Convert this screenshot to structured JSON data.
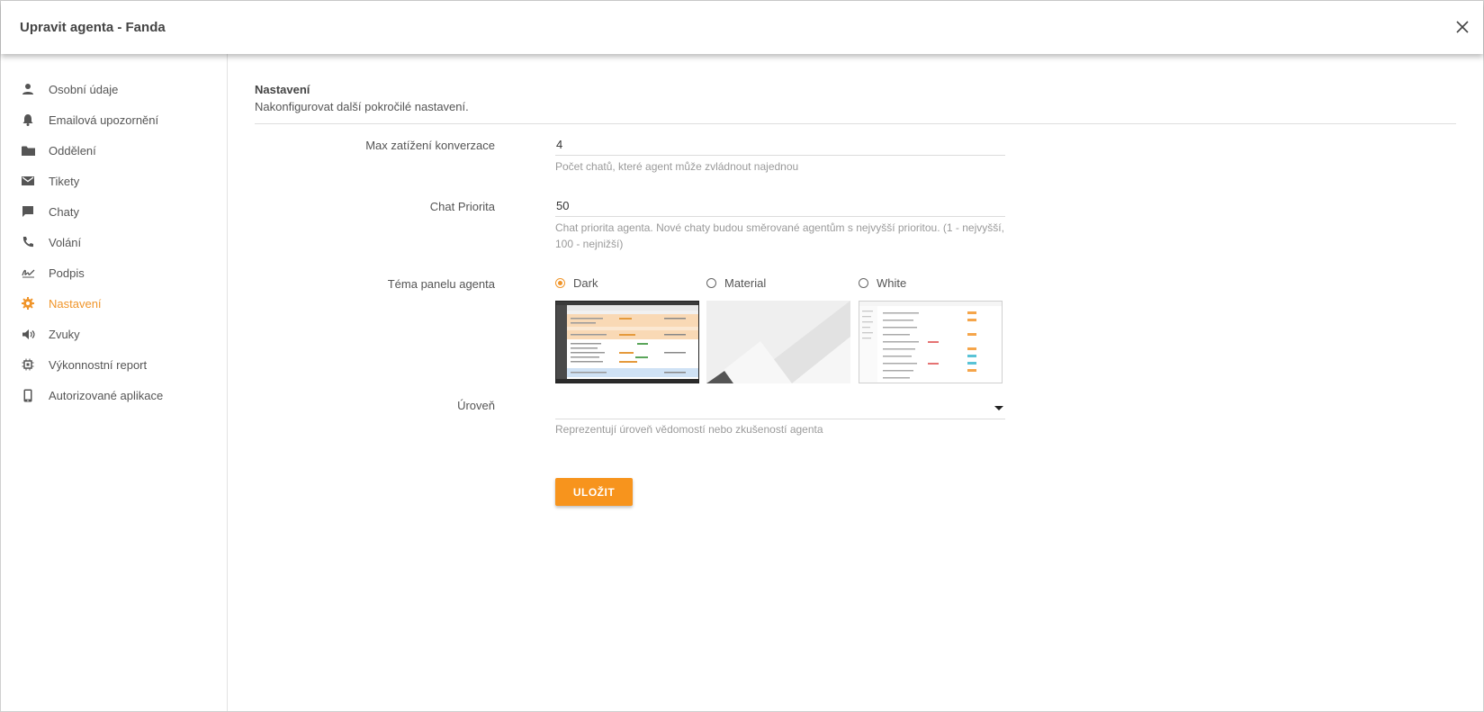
{
  "header": {
    "title": "Upravit agenta - Fanda"
  },
  "sidebar": {
    "items": [
      {
        "label": "Osobní údaje",
        "icon": "person-icon"
      },
      {
        "label": "Emailová upozornění",
        "icon": "bell-icon"
      },
      {
        "label": "Oddělení",
        "icon": "folder-icon"
      },
      {
        "label": "Tikety",
        "icon": "mail-icon"
      },
      {
        "label": "Chaty",
        "icon": "chat-icon"
      },
      {
        "label": "Volání",
        "icon": "phone-icon"
      },
      {
        "label": "Podpis",
        "icon": "signature-icon"
      },
      {
        "label": "Nastavení",
        "icon": "gear-icon",
        "active": true
      },
      {
        "label": "Zvuky",
        "icon": "speaker-icon"
      },
      {
        "label": "Výkonnostní report",
        "icon": "chip-icon"
      },
      {
        "label": "Autorizované aplikace",
        "icon": "mobile-icon"
      }
    ]
  },
  "main": {
    "title": "Nastavení",
    "description": "Nakonfigurovat další pokročilé nastavení.",
    "max_load": {
      "label": "Max zatížení konverzace",
      "value": "4",
      "hint": "Počet chatů, které agent může zvládnout najednou"
    },
    "chat_priority": {
      "label": "Chat Priorita",
      "value": "50",
      "hint": "Chat priorita agenta. Nové chaty budou směrované agentům s nejvyšší prioritou. (1 - nejvyšší, 100 - nejnižší)"
    },
    "theme": {
      "label": "Téma panelu agenta",
      "options": [
        "Dark",
        "Material",
        "White"
      ],
      "selected": "Dark"
    },
    "level": {
      "label": "Úroveň",
      "value": "",
      "hint": "Reprezentují úroveň vědomostí nebo zkušeností agenta"
    },
    "save_label": "ULOŽIT"
  },
  "colors": {
    "accent": "#f7941d",
    "active_nav": "#f0952a"
  }
}
